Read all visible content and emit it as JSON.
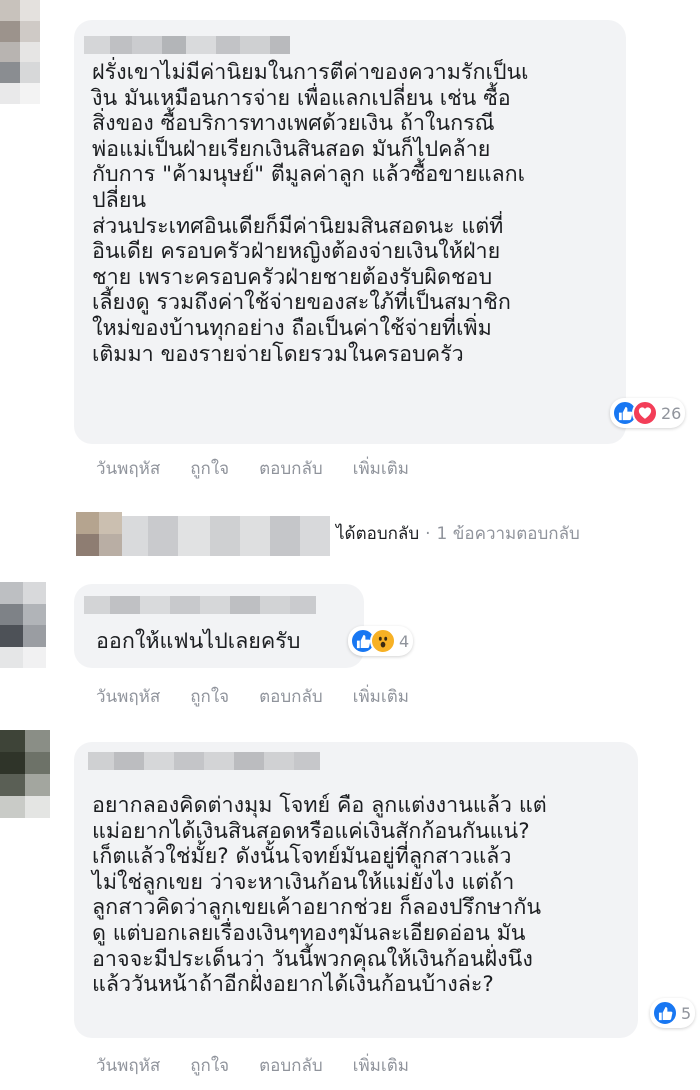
{
  "comments": [
    {
      "text": "ฝรั่งเขาไม่มีค่านิยมในการตีค่าของความรักเป็นเ\nงิน มันเหมือนการจ่าย เพื่อแลกเปลี่ยน เช่น ซื้อ\nสิ่งของ ซื้อบริการทางเพศด้วยเงิน ถ้าในกรณี\nพ่อแม่เป็นฝ่ายเรียกเงินสินสอด มันก็ไปคล้าย\nกับการ \"ค้ามนุษย์\" ตีมูลค่าลูก แล้วซื้อขายแลกเ\nปลี่ยน\nส่วนประเทศอินเดียก็มีค่านิยมสินสอดนะ แต่ที่\nอินเดีย ครอบครัวฝ่ายหญิงต้องจ่ายเงินให้ฝ่าย\nชาย เพราะครอบครัวฝ่ายชายต้องรับผิดชอบ\nเลี้ยงดู รวมถึงค่าใช้จ่ายของสะใภ้ที่เป็นสมาชิก\nใหม่ของบ้านทุกอย่าง ถือเป็นค่าใช้จ่ายที่เพิ่ม\nเติมมา ของรายจ่ายโดยรวมในครอบครัว",
      "reactions": [
        "like",
        "love"
      ],
      "reaction_count": "26"
    },
    {
      "text": "ออกให้แฟนไปเลยครับ",
      "reactions": [
        "like",
        "wow"
      ],
      "reaction_count": "4"
    },
    {
      "text": "อยากลองคิดต่างมุม โจทย์ คือ ลูกแต่งงานแล้ว แต่\nแม่อยากได้เงินสินสอดหรือแค่เงินสักก้อนกันแน่?\nเก็ตแล้วใช่มั้ย? ดังนั้นโจทย์มันอยู่ที่ลูกสาวแล้ว\nไม่ใช่ลูกเขย ว่าจะหาเงินก้อนให้แม่ยังไง แต่ถ้า\nลูกสาวคิดว่าลูกเขยเค้าอยากช่วย ก็ลองปรึกษากัน\nดู แต่บอกเลยเรื่องเงินๆทองๆมันละเอียดอ่อน มัน\nอาจจะมีประเด็นว่า วันนี้พวกคุณให้เงินก้อนฝั่งนึง\nแล้ววันหน้าถ้าอีกฝั่งอยากได้เงินก้อนบ้างล่ะ?",
      "reactions": [
        "like"
      ],
      "reaction_count": "5"
    }
  ],
  "actions": {
    "time": "วันพฤหัส",
    "like": "ถูกใจ",
    "reply": "ตอบกลับ",
    "more": "เพิ่มเติม"
  },
  "reply_summary": {
    "replied": "ได้ตอบกลับ",
    "separator": "·",
    "count": "1 ข้อความตอบกลับ"
  },
  "colors": {
    "bubble": "#f2f3f5",
    "like_blue": "#1877f2",
    "love_red": "#f33e58",
    "wow_yellow": "#f7b125",
    "meta_gray": "#90949c"
  },
  "icons": {
    "like": "thumbs-up-icon",
    "love": "heart-icon",
    "wow": "wow-face-icon"
  }
}
